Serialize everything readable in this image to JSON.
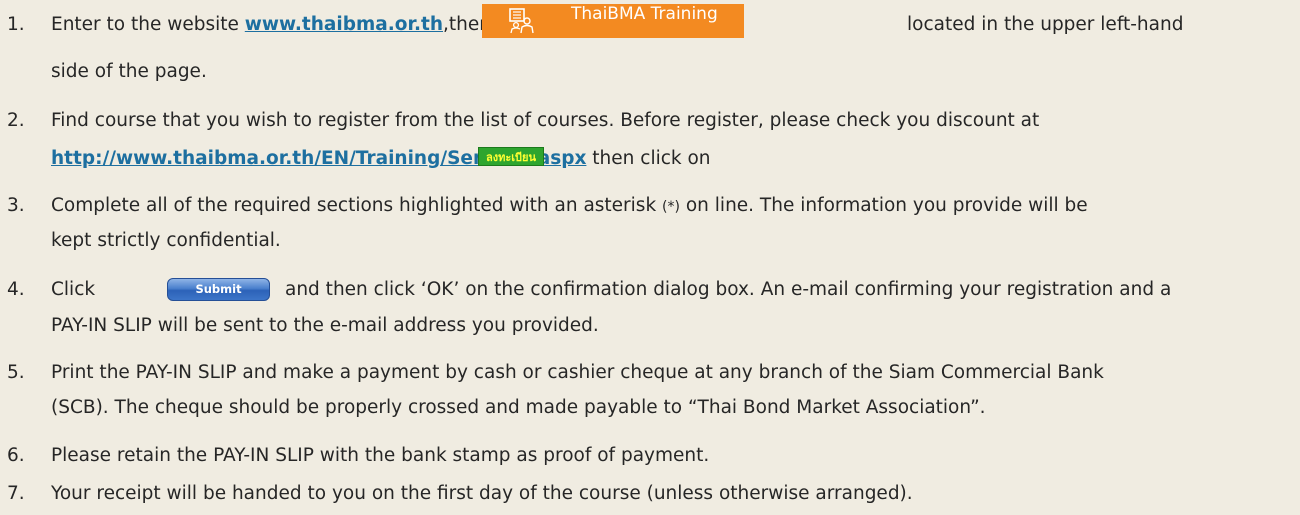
{
  "steps": [
    {
      "number": "1.",
      "text_before": "Enter to the website ",
      "link": "www.thaibma.or.th",
      "text_after": ",then click",
      "button_label": "ThaiBMA Training",
      "text_tail": "located in the upper left-hand",
      "line2": "side of the page."
    },
    {
      "number": "2.",
      "line1": "Find course that you wish to register from the list of courses. Before register, please check you discount at",
      "link": "http://www.thaibma.or.th/EN/Training/Seminar.aspx",
      "text_after": " then click on",
      "button_label": "ลงทะเบียน"
    },
    {
      "number": "3.",
      "text_before": "Complete all of the required sections highlighted with an asterisk ",
      "asterisk": "(*)",
      "text_after": " on line. The information you provide will be",
      "line2": "kept strictly confidential."
    },
    {
      "number": "4.",
      "text_before": "Click",
      "button_label": "Submit",
      "text_after": "and then click ‘OK’ on the confirmation dialog box. An e-mail confirming your registration and a",
      "line2": "PAY-IN SLIP will be sent to the e-mail address you provided."
    },
    {
      "number": "5.",
      "line1": "Print the PAY-IN SLIP and make a payment by cash or cashier cheque at any branch of the Siam Commercial Bank",
      "line2": "(SCB). The cheque should be properly crossed and made payable to “Thai Bond Market Association”."
    },
    {
      "number": "6.",
      "line1": "Please retain the PAY-IN SLIP with the bank stamp as proof of payment."
    },
    {
      "number": "7.",
      "line1": "Your receipt will be handed to you on the first day of the course (unless otherwise arranged)."
    }
  ],
  "colors": {
    "background": "#f0ece1",
    "text": "#262626",
    "link": "#1d6fa0",
    "training_button": "#f38a21",
    "register_button": "#2ea52e",
    "submit_button": "#3d75c8"
  },
  "icons": {
    "training_button_icon": "building-people-icon"
  }
}
